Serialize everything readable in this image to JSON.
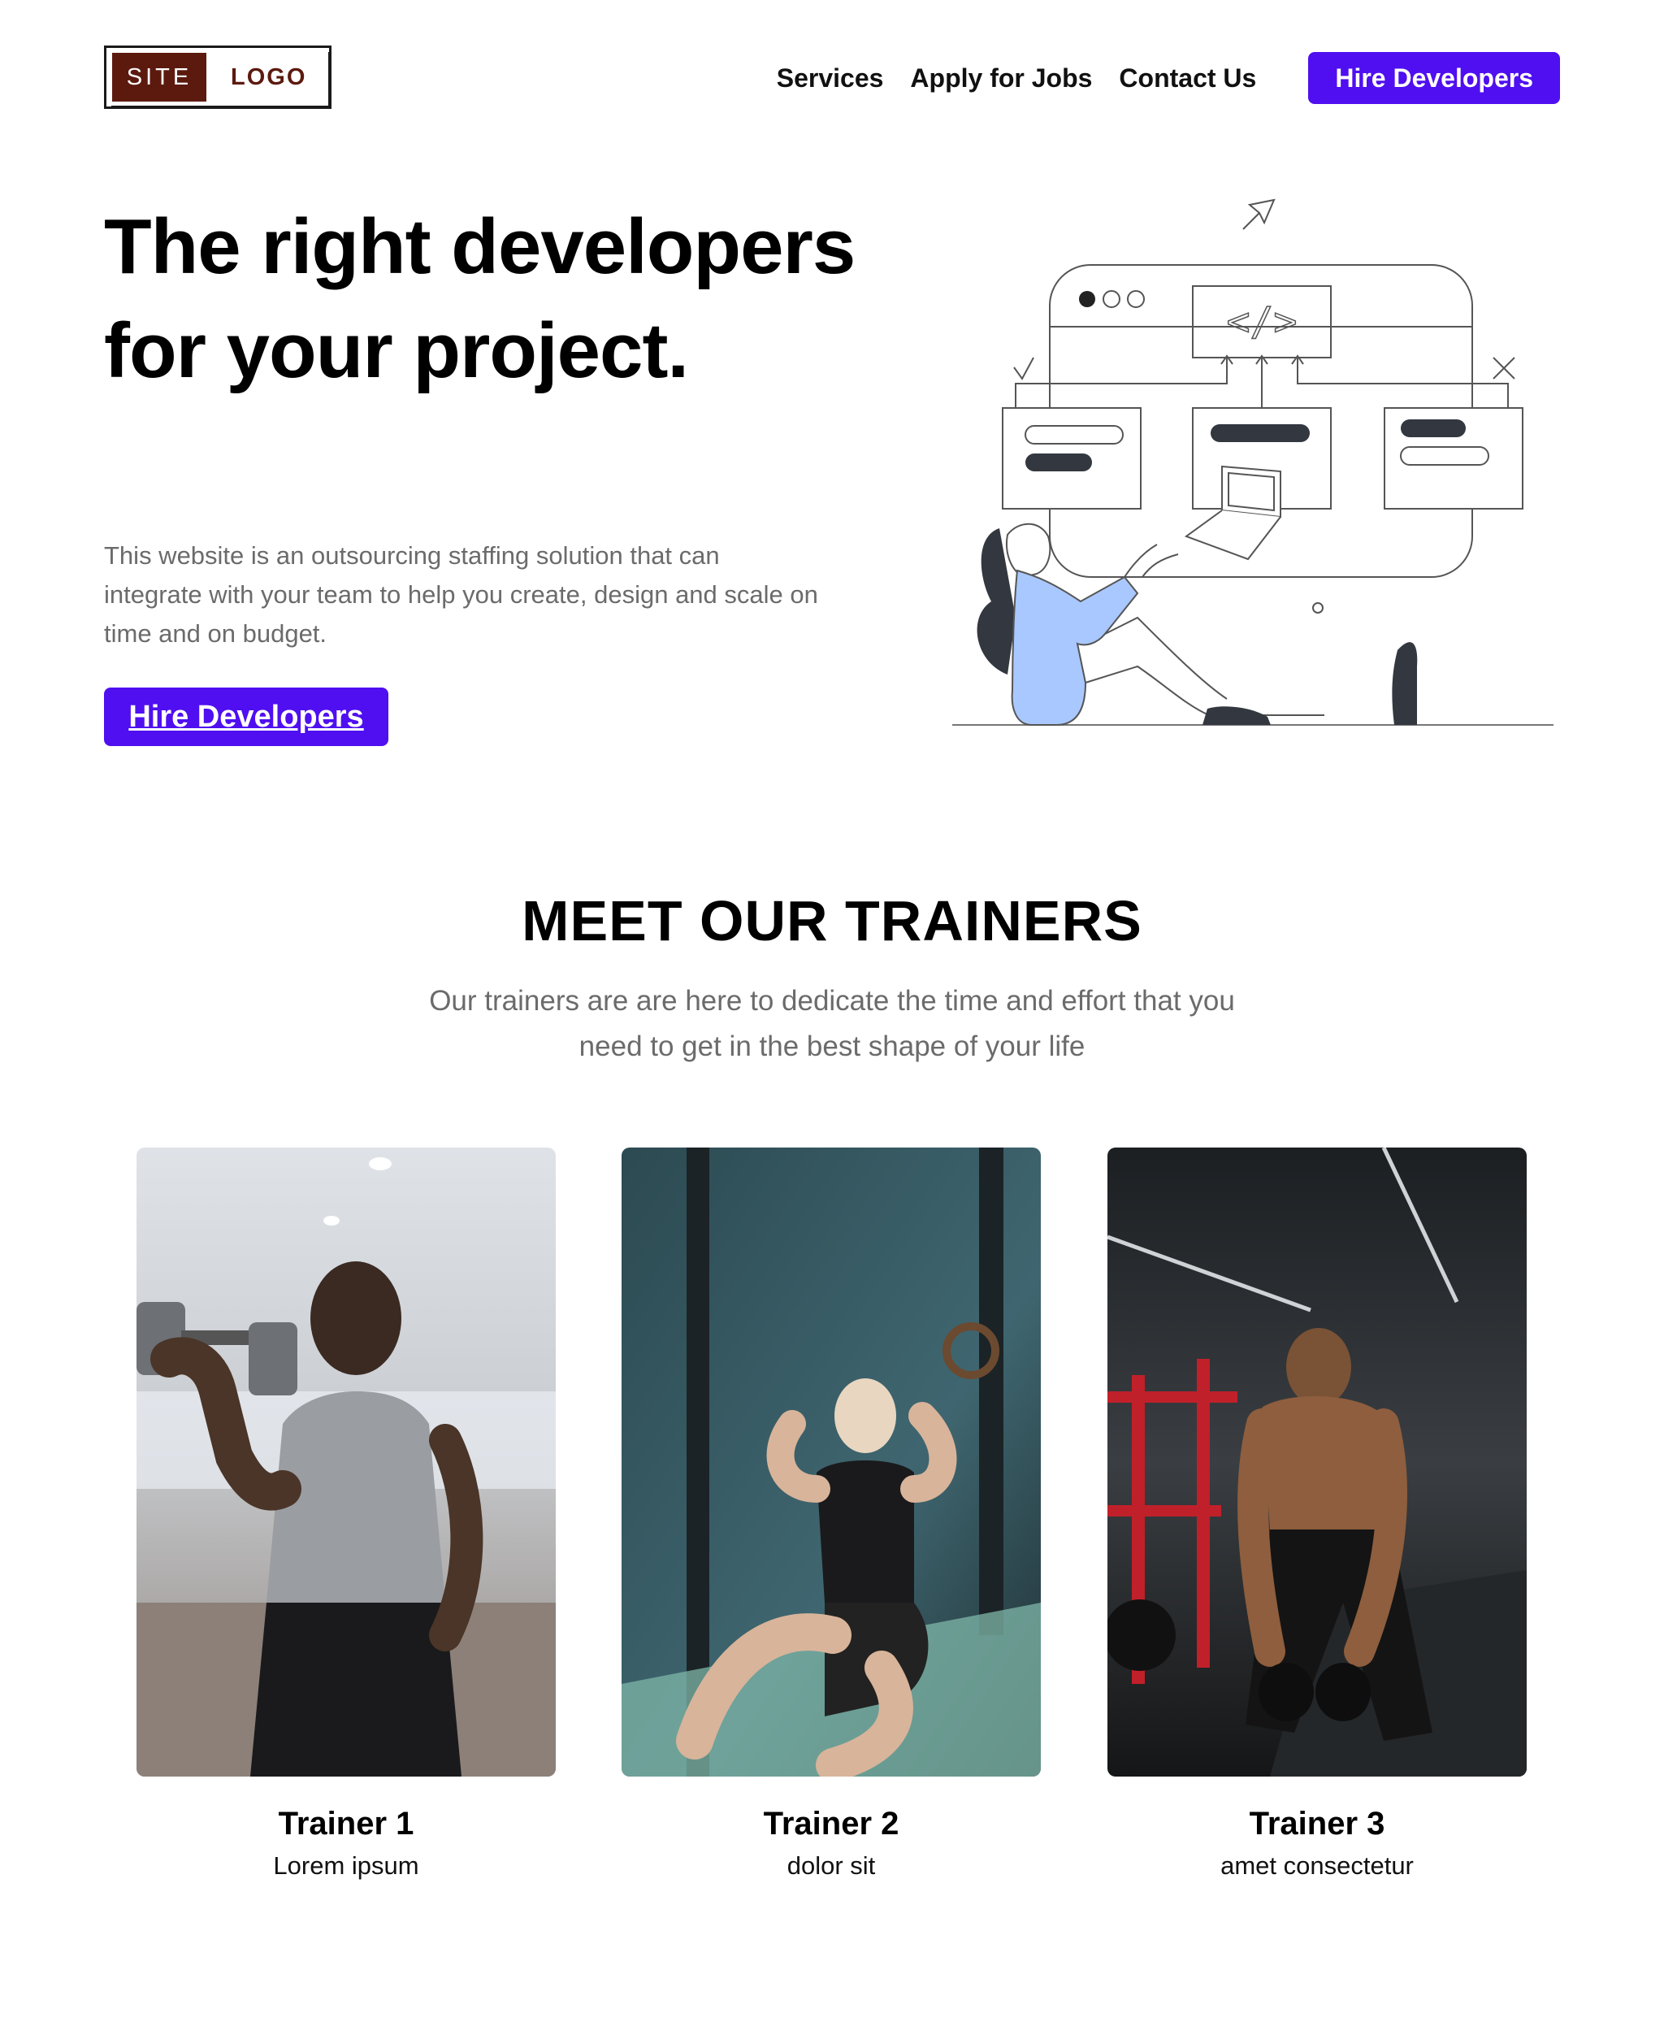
{
  "header": {
    "logo_site": "SITE",
    "logo_logo": "LOGO",
    "nav": {
      "services": "Services",
      "apply": "Apply for Jobs",
      "contact": "Contact Us",
      "hire": "Hire Developers"
    }
  },
  "hero": {
    "title": "The right developers for your project.",
    "description": "This website is an outsourcing staffing solution that can integrate with your team to help you create, design and scale on time and on budget.",
    "cta": "Hire Developers",
    "illustration_code_label": "</>"
  },
  "trainers": {
    "title": "MEET OUR TRAINERS",
    "subtitle": "Our trainers are are here to dedicate the time and effort that you need to get in the best shape of your life",
    "items": [
      {
        "name": "Trainer 1",
        "role": "Lorem ipsum"
      },
      {
        "name": "Trainer 2",
        "role": "dolor sit"
      },
      {
        "name": "Trainer 3",
        "role": "amet consectetur"
      }
    ]
  },
  "colors": {
    "accent": "#4f0ff0",
    "logo_brand": "#5c1a0f",
    "muted_text": "#6b6b6b",
    "illustration_blue": "#a9c8ff"
  }
}
